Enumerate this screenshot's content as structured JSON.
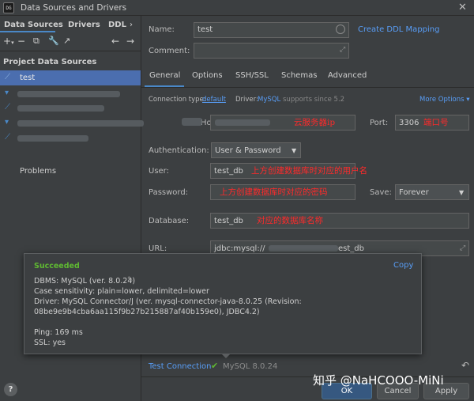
{
  "window": {
    "title": "Data Sources and Drivers",
    "app_icon_text": "DG"
  },
  "left": {
    "tabs": [
      "Data Sources",
      "Drivers",
      "DDL"
    ],
    "section_title": "Project Data Sources",
    "items": [
      {
        "label": "test"
      }
    ],
    "problems": "Problems"
  },
  "form": {
    "name_label": "Name:",
    "name_value": "test",
    "create_ddl": "Create DDL Mapping",
    "comment_label": "Comment:",
    "tabs": [
      "General",
      "Options",
      "SSH/SSL",
      "Schemas",
      "Advanced"
    ],
    "conn_type_label": "Connection type:",
    "conn_type_value": "default",
    "driver_label": "Driver:",
    "driver_value": "MySQL",
    "driver_note": "supports since 5.2",
    "more_options": "More Options ▾",
    "host_label": "Host:",
    "host_anno": "云服务器ip",
    "port_label": "Port:",
    "port_value": "3306",
    "port_anno": "端口号",
    "auth_label": "Authentication:",
    "auth_value": "User & Password",
    "user_label": "User:",
    "user_value": "test_db",
    "user_anno": "上方创建数据库时对应的用户名",
    "password_label": "Password:",
    "password_anno": "上方创建数据库时对应的密码",
    "save_label": "Save:",
    "save_value": "Forever",
    "db_label": "Database:",
    "db_value": "test_db",
    "db_anno": "对应的数据库名称",
    "url_label": "URL:",
    "url_prefix": "jdbc:mysql://",
    "url_suffix": "est_db"
  },
  "popup": {
    "status": "Succeeded",
    "copy": "Copy",
    "lines": [
      "DBMS: MySQL (ver. 8.0.24)",
      "Case sensitivity: plain=lower, delimited=lower",
      "Driver: MySQL Connector/J (ver. mysql-connector-java-8.0.25 (Revision:",
      "08be9e9b4cba6aa115f9b27b215887af40b159e0), JDBC4.2)",
      "Ping: 169 ms",
      "SSL: yes"
    ]
  },
  "bottom": {
    "test_connection": "Test Connection",
    "status_text": "MySQL 8.0.24",
    "ok": "OK",
    "cancel": "Cancel",
    "apply": "Apply",
    "help": "?",
    "watermark": "知乎 @NaHCOOO-MiNi"
  },
  "colors": {
    "accent": "#4a88c7",
    "link": "#589df6",
    "success": "#5fb832",
    "annotation": "#ff2a2a",
    "background": "#3c3f41"
  }
}
